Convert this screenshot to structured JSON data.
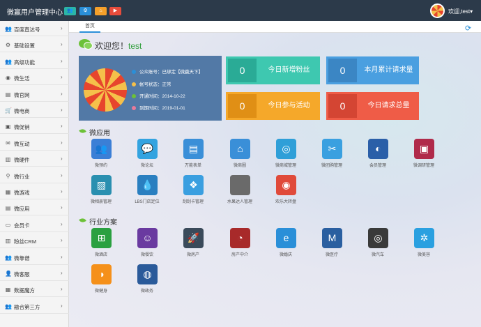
{
  "header": {
    "brand": "微赢用户管理中心",
    "buttons": [
      {
        "name": "user-group",
        "icon": "user-group-icon",
        "glyph": "👥",
        "color": "#2bb5a7"
      },
      {
        "name": "settings",
        "icon": "gear-icon",
        "glyph": "⚙",
        "color": "#2a8fd8"
      },
      {
        "name": "home",
        "icon": "home-icon",
        "glyph": "⌂",
        "color": "#f5a02a"
      },
      {
        "name": "play",
        "icon": "play-icon",
        "glyph": "▶",
        "color": "#e74c3c"
      }
    ],
    "user_name": "欢迎,test",
    "user_caret": "▾"
  },
  "sidebar": {
    "arrow": "›",
    "items": [
      {
        "label": "百度直达号",
        "icon": "users-icon",
        "glyph": "👥"
      },
      {
        "label": "基础设置",
        "icon": "gear-icon",
        "glyph": "⚙"
      },
      {
        "label": "高级功能",
        "icon": "users-icon",
        "glyph": "👥"
      },
      {
        "label": "微生活",
        "icon": "eye-icon",
        "glyph": "◉"
      },
      {
        "label": "微官网",
        "icon": "list-icon",
        "glyph": "▤"
      },
      {
        "label": "微电商",
        "icon": "cart-icon",
        "glyph": "🛒"
      },
      {
        "label": "微促销",
        "icon": "coupon-icon",
        "glyph": "▣"
      },
      {
        "label": "微互动",
        "icon": "chat-icon",
        "glyph": "✉"
      },
      {
        "label": "微硬件",
        "icon": "chart-icon",
        "glyph": "▥"
      },
      {
        "label": "微行业",
        "icon": "search-icon",
        "glyph": "⚲"
      },
      {
        "label": "微游戏",
        "icon": "game-icon",
        "glyph": "▦"
      },
      {
        "label": "微应用",
        "icon": "app-icon",
        "glyph": "▤"
      },
      {
        "label": "会员卡",
        "icon": "card-icon",
        "glyph": "▭"
      },
      {
        "label": "粉丝CRM",
        "icon": "chart-icon",
        "glyph": "▥"
      },
      {
        "label": "微靠谱",
        "icon": "users-icon",
        "glyph": "👥"
      },
      {
        "label": "微客服",
        "icon": "user-icon",
        "glyph": "👤"
      },
      {
        "label": "数据魔方",
        "icon": "cube-icon",
        "glyph": "▦"
      },
      {
        "label": "融合第三方",
        "icon": "users-icon",
        "glyph": "👥"
      }
    ]
  },
  "tabs": {
    "home": "首页",
    "refresh_icon": "refresh-icon",
    "refresh_glyph": "⟳"
  },
  "welcome": {
    "prefix": "欢迎您！",
    "user": "test"
  },
  "account": {
    "rows": [
      {
        "text": "公众账号：已绑定【微赢天下】",
        "color": "#2a8fd8"
      },
      {
        "text": "帐号状态：正常",
        "color": "#f5c04a"
      },
      {
        "text": "开通时间：2014-10-22",
        "color": "#6cc138"
      },
      {
        "text": "到期时间：2019-01-01",
        "color": "#e87a9a"
      }
    ]
  },
  "stats": [
    {
      "value": "0",
      "label": "今日新增粉丝",
      "color": "#3ec8b0",
      "box": "#2aab96"
    },
    {
      "value": "0",
      "label": "本月累计请求量",
      "color": "#4a9fe0",
      "box": "#3b86c4"
    },
    {
      "value": "0",
      "label": "今日参与活动",
      "color": "#f5a82a",
      "box": "#e08f15"
    },
    {
      "value": "0",
      "label": "今日请求总量",
      "color": "#ef5c47",
      "box": "#d44533"
    }
  ],
  "sections": {
    "apps_title": "微应用",
    "industry_title": "行业方案"
  },
  "apps": [
    {
      "label": "微预约",
      "icon": "users-icon",
      "glyph": "👥",
      "color": "#3b7fd6"
    },
    {
      "label": "微论坛",
      "icon": "chat-icon",
      "glyph": "💬",
      "color": "#33a3e0"
    },
    {
      "label": "万能表单",
      "icon": "form-icon",
      "glyph": "▤",
      "color": "#3a8fd8"
    },
    {
      "label": "微商圈",
      "icon": "home-icon",
      "glyph": "⌂",
      "color": "#3a8fd8"
    },
    {
      "label": "微商城管理",
      "icon": "film-icon",
      "glyph": "◎",
      "color": "#2f9fd8"
    },
    {
      "label": "微团购管理",
      "icon": "tools-icon",
      "glyph": "✂",
      "color": "#3aa0e0"
    },
    {
      "label": "会员管理",
      "icon": "browser-icon",
      "glyph": "◐",
      "color": "#2a5fa8"
    },
    {
      "label": "微调研管理",
      "icon": "survey-icon",
      "glyph": "▣",
      "color": "#b02a4a"
    },
    {
      "label": "微相册管理",
      "icon": "photo-icon",
      "glyph": "▨",
      "color": "#2a8fb0"
    },
    {
      "label": "LBS门店定位",
      "icon": "drop-icon",
      "glyph": "💧",
      "color": "#2a7fc0"
    },
    {
      "label": "刮刮卡管理",
      "icon": "dropbox-icon",
      "glyph": "❖",
      "color": "#3a9fe0"
    },
    {
      "label": "水果达人管理",
      "icon": "apple-icon",
      "glyph": "",
      "color": "#6a6a6a"
    },
    {
      "label": "欢乐大转盘",
      "icon": "chrome-icon",
      "glyph": "◉",
      "color": "#e04a3a"
    }
  ],
  "industry": [
    {
      "label": "微酒店",
      "icon": "windows-icon",
      "glyph": "⊞",
      "color": "#2aa040"
    },
    {
      "label": "微餐饮",
      "icon": "smiley-icon",
      "glyph": "☺",
      "color": "#6a3aa0"
    },
    {
      "label": "微房产",
      "icon": "rocket-icon",
      "glyph": "🚀",
      "color": "#3a4a5a"
    },
    {
      "label": "房产中介",
      "icon": "firefox-icon",
      "glyph": "◔",
      "color": "#a82a2a"
    },
    {
      "label": "微婚庆",
      "icon": "ie-icon",
      "glyph": "e",
      "color": "#2a8fd8"
    },
    {
      "label": "微医疗",
      "icon": "maxthon-icon",
      "glyph": "M",
      "color": "#2a5fa0"
    },
    {
      "label": "微汽车",
      "icon": "compass-icon",
      "glyph": "◎",
      "color": "#3a3a3a"
    },
    {
      "label": "微美容",
      "icon": "tools-icon",
      "glyph": "✲",
      "color": "#2aa0e0"
    },
    {
      "label": "微健身",
      "icon": "firefox-icon",
      "glyph": "◑",
      "color": "#f5901a"
    },
    {
      "label": "微政务",
      "icon": "globe-icon",
      "glyph": "◍",
      "color": "#2a5a9a"
    }
  ]
}
